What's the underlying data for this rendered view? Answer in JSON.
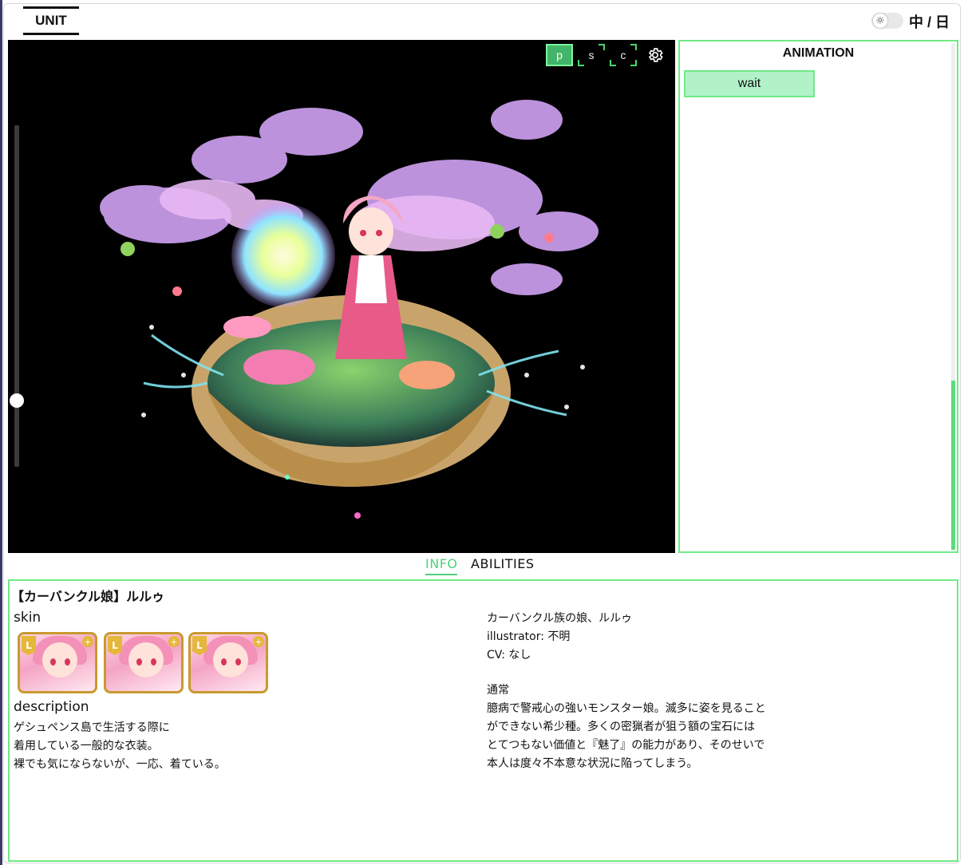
{
  "header": {
    "tab_unit": "UNIT",
    "language": "中 / 日",
    "theme_icon": "sun-icon"
  },
  "viewer": {
    "buttons": [
      "p",
      "s",
      "c"
    ],
    "active_button": "p",
    "settings_icon": "gear-icon",
    "zoom_level": 0.2,
    "colors": {
      "background": "#000000",
      "accent": "#43b56a"
    }
  },
  "animation_panel": {
    "title": "ANIMATION",
    "items": [
      "wait"
    ],
    "selected": "wait"
  },
  "tabs": {
    "info": "INFO",
    "abilities": "ABILITIES",
    "active": "INFO"
  },
  "info": {
    "name": "【カーバンクル娘】ルルゥ",
    "skin_label": "skin",
    "skins": [
      {
        "badge": "L"
      },
      {
        "badge": "L"
      },
      {
        "badge": "L"
      }
    ],
    "description_label": "description",
    "description_lines": [
      "ゲシュペンス島で生活する際に",
      "着用している一般的な衣装。",
      "裸でも気にならないが、一応、着ている。"
    ],
    "profile_lines": [
      "カーバンクル族の娘、ルルゥ",
      "illustrator: 不明",
      "CV: なし"
    ],
    "story_title": "通常",
    "story_lines": [
      "臆病で警戒心の強いモンスター娘。滅多に姿を見ること",
      "ができない希少種。多くの密猟者が狙う額の宝石には",
      "とてつもない価値と『魅了』の能力があり、そのせいで",
      "本人は度々不本意な状況に陥ってしまう。"
    ]
  },
  "colors": {
    "green_border": "#6fea86",
    "green_active": "#4fcf7a"
  }
}
